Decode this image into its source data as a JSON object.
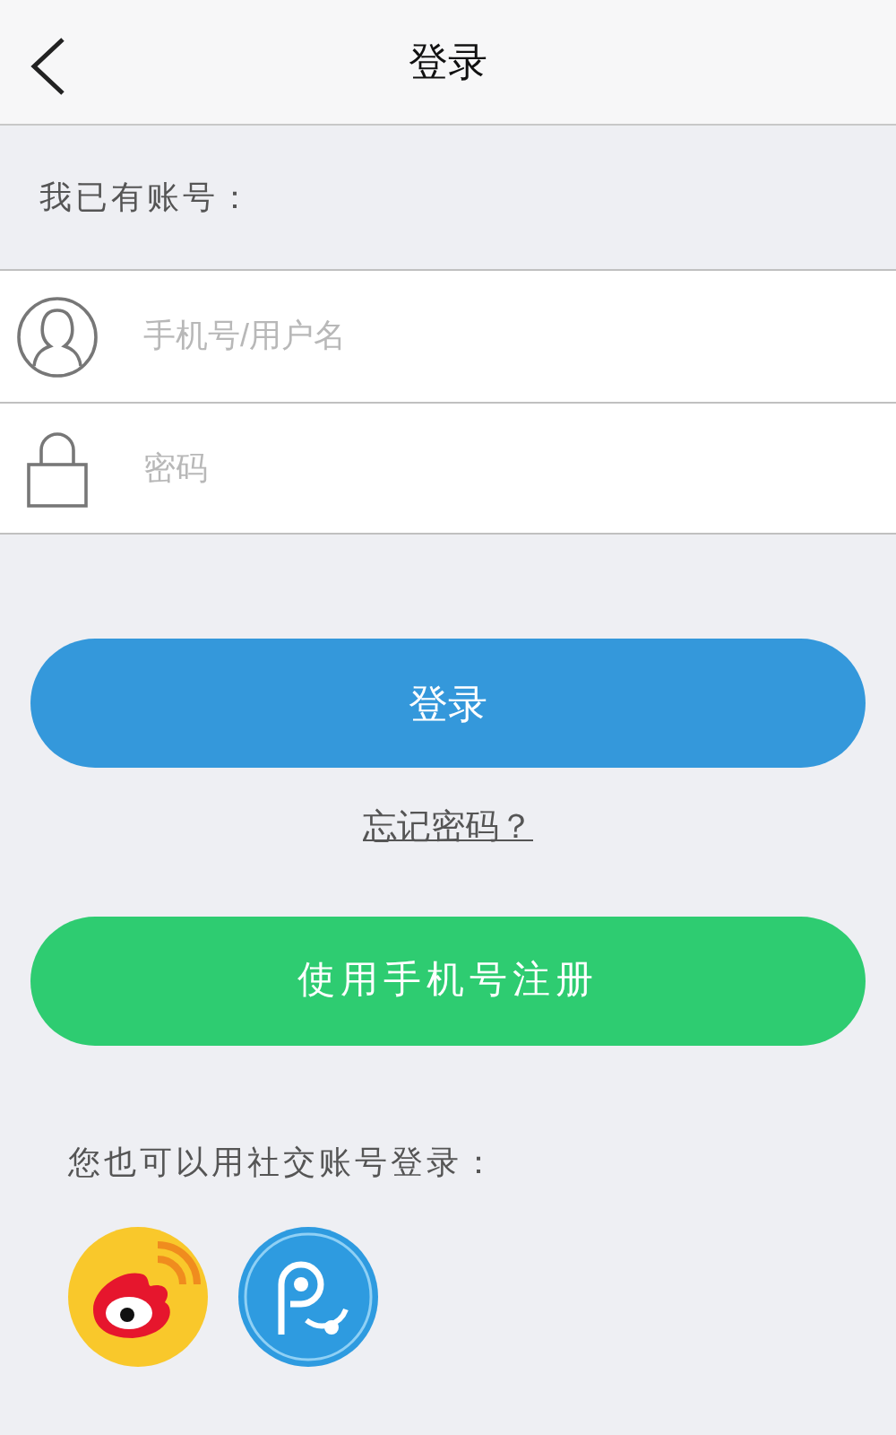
{
  "header": {
    "title": "登录"
  },
  "section_label": "我已有账号：",
  "fields": [
    {
      "kind": "user",
      "placeholder": "手机号/用户名"
    },
    {
      "kind": "password",
      "placeholder": "密码"
    }
  ],
  "login_button": "登录",
  "forgot_link": "忘记密码？",
  "register_button": "使用手机号注册",
  "social_label": "您也可以用社交账号登录：",
  "social_logins": [
    {
      "kind": "eye"
    },
    {
      "kind": "bulb"
    }
  ]
}
